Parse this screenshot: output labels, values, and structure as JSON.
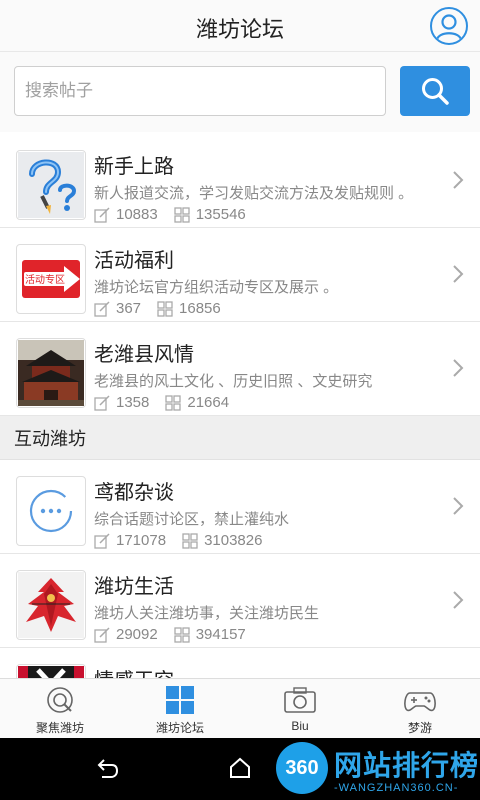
{
  "header": {
    "title": "潍坊论坛"
  },
  "search": {
    "placeholder": "搜索帖子"
  },
  "forums": [
    {
      "name": "新手上路",
      "desc": "新人报道交流，学习发贴交流方法及发贴规则 。",
      "threads": "10883",
      "posts": "135546",
      "icon": "question-marks-icon"
    },
    {
      "name": "活动福利",
      "desc": "潍坊论坛官方组织活动专区及展示 。",
      "threads": "367",
      "posts": "16856",
      "icon": "activity-zone-icon",
      "icon_text": "活动专区"
    },
    {
      "name": "老潍县风情",
      "desc": "老潍县的风土文化 、历史旧照 、文史研究",
      "threads": "1358",
      "posts": "21664",
      "icon": "old-tower-photo"
    }
  ],
  "section2": {
    "title": "互动潍坊"
  },
  "forums2": [
    {
      "name": "鸢都杂谈",
      "desc": "综合话题讨论区，禁止灌纯水",
      "threads": "171078",
      "posts": "3103826",
      "icon": "chat-bubble-icon"
    },
    {
      "name": "潍坊生活",
      "desc": "潍坊人关注潍坊事，关注潍坊民生",
      "threads": "29092",
      "posts": "394157",
      "icon": "kite-photo"
    },
    {
      "name": "情感天空",
      "icon": "partial-photo"
    }
  ],
  "tabs": [
    {
      "label": "聚焦潍坊",
      "icon": "focus-icon"
    },
    {
      "label": "潍坊论坛",
      "icon": "grid-icon",
      "active": true
    },
    {
      "label": "Biu",
      "icon": "camera-icon"
    },
    {
      "label": "梦游",
      "icon": "gamepad-icon"
    }
  ],
  "watermark": {
    "badge": "360",
    "title": "网站排行榜",
    "subtitle": "-WANGZHAN360.CN-"
  },
  "colors": {
    "accent": "#2f8fe0",
    "red": "#e0242a"
  }
}
